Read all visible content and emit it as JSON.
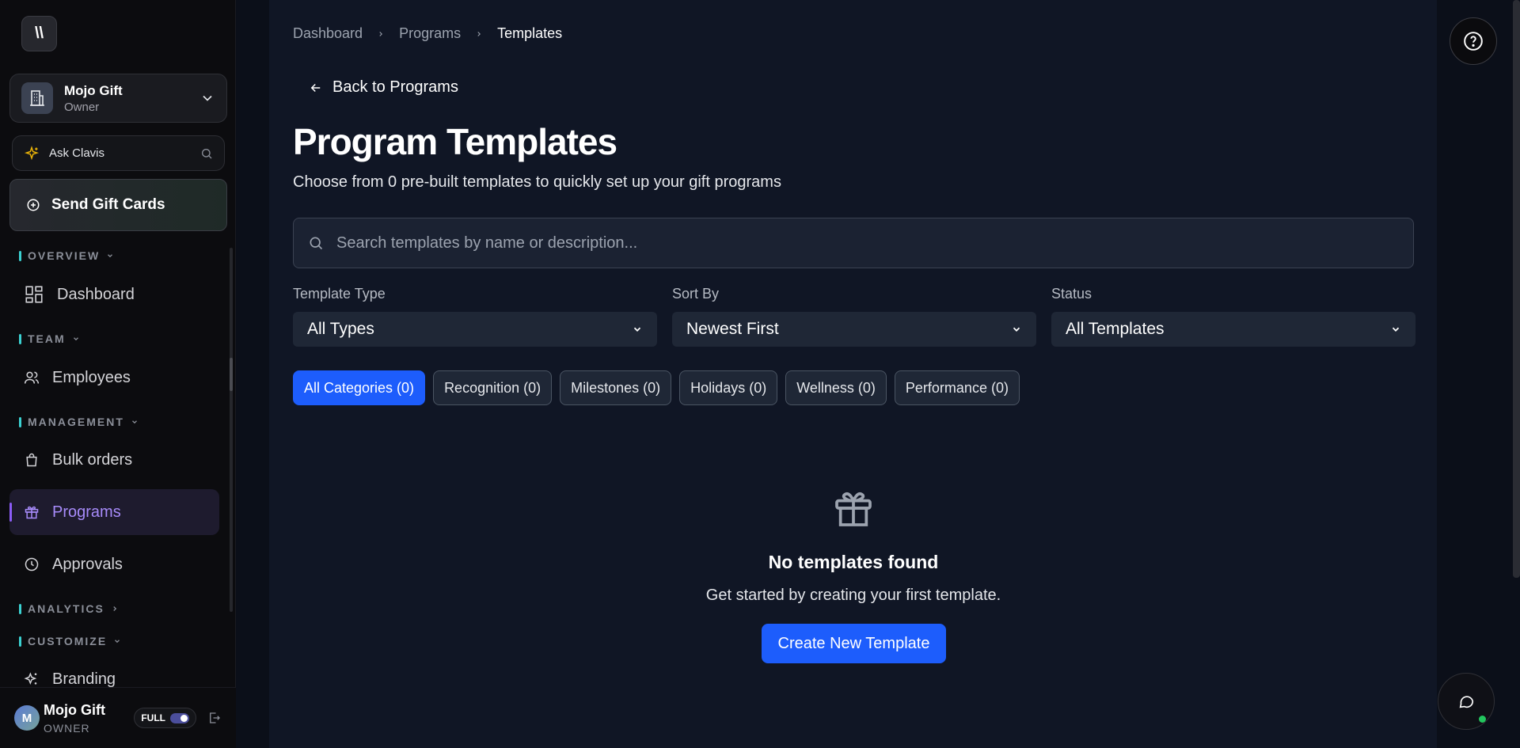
{
  "sidebar": {
    "logo_text": "\\\\",
    "org": {
      "name": "Mojo Gift",
      "role": "Owner"
    },
    "ask": {
      "label": "Ask Clavis"
    },
    "send": {
      "label": "Send Gift Cards"
    },
    "sections": {
      "overview": "OVERVIEW",
      "team": "TEAM",
      "management": "MANAGEMENT",
      "analytics": "ANALYTICS",
      "customize": "CUSTOMIZE"
    },
    "items": {
      "dashboard": "Dashboard",
      "employees": "Employees",
      "bulk_orders": "Bulk orders",
      "programs": "Programs",
      "approvals": "Approvals",
      "branding": "Branding"
    },
    "footer": {
      "avatar_initial": "M",
      "name": "Mojo Gift",
      "role": "OWNER",
      "mode": "FULL"
    }
  },
  "breadcrumb": {
    "items": [
      "Dashboard",
      "Programs",
      "Templates"
    ]
  },
  "back_label": "Back to Programs",
  "page": {
    "title": "Program Templates",
    "subtitle": "Choose from 0 pre-built templates to quickly set up your gift programs"
  },
  "search": {
    "placeholder": "Search templates by name or description..."
  },
  "filters": {
    "type": {
      "label": "Template Type",
      "value": "All Types"
    },
    "sort": {
      "label": "Sort By",
      "value": "Newest First"
    },
    "status": {
      "label": "Status",
      "value": "All Templates"
    }
  },
  "categories": [
    "All Categories (0)",
    "Recognition (0)",
    "Milestones (0)",
    "Holidays (0)",
    "Wellness (0)",
    "Performance (0)"
  ],
  "empty": {
    "title": "No templates found",
    "subtitle": "Get started by creating your first template.",
    "button": "Create New Template"
  },
  "colors": {
    "accent": "#1d5dfc",
    "active_nav": "#a78bfa",
    "section_bar": "#3bd1d1"
  }
}
